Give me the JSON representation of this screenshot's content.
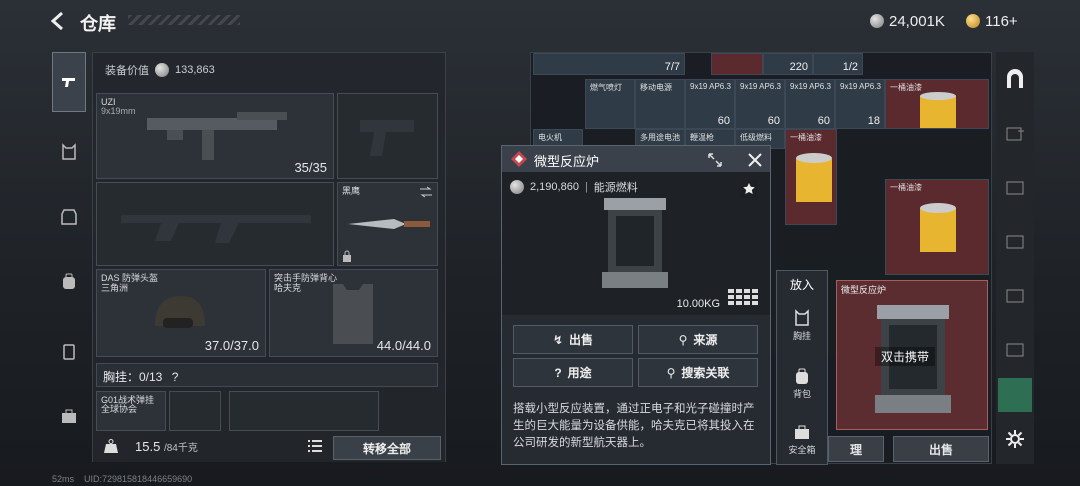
{
  "header": {
    "title": "仓库"
  },
  "currency": {
    "silver": "24,001K",
    "gold": "116+"
  },
  "equipment": {
    "value_label": "装备价值",
    "value": "133,863",
    "primary_weapon": {
      "name": "UZI",
      "sub": "9x19mm",
      "ammo": "35/35"
    },
    "melee": {
      "name": "黑鹰"
    },
    "helmet": {
      "name": "DAS 防弹头盔",
      "sub": "三角洲",
      "durability": "37.0/37.0"
    },
    "armor": {
      "name": "突击手防弹背心",
      "sub": "哈夫克",
      "durability": "44.0/44.0"
    },
    "chest_rig": {
      "label": "胸挂：0/13",
      "help": "?"
    },
    "rig_item": {
      "name": "G01战术弹挂",
      "sub": "全球协会"
    },
    "weight": "15.5",
    "weight_max": "/84千克",
    "transfer_all": "转移全部"
  },
  "storage": {
    "row1": [
      "7/7",
      "220",
      "1/2"
    ],
    "row2": [
      {
        "name": "燃气喷灯",
        "qty": ""
      },
      {
        "name": "移动电源",
        "qty": ""
      },
      {
        "name": "9x19 AP6.3",
        "qty": "60"
      },
      {
        "name": "9x19 AP6.3",
        "qty": "60"
      },
      {
        "name": "9x19 AP6.3",
        "qty": "60"
      },
      {
        "name": "9x19 AP6.3",
        "qty": "18"
      },
      {
        "name": "一桶油漆",
        "qty": ""
      }
    ],
    "row3": [
      {
        "name": "电火机"
      },
      {
        "name": "多用途电池"
      },
      {
        "name": "鞭温枪"
      },
      {
        "name": "低级燃料"
      },
      {
        "name": "一桶油漆"
      },
      {
        "name": "一桶油漆"
      }
    ],
    "selected_name": "微型反应炉",
    "double_click_hint": "双击携带",
    "sell_label": "出售",
    "organize_label": "理"
  },
  "popup": {
    "title": "微型反应炉",
    "price": "2,190,860",
    "category": "能源燃料",
    "weight": "10.00KG",
    "buttons": {
      "sell": "出售",
      "source": "来源",
      "use": "用途",
      "search": "搜索关联"
    },
    "description": "搭载小型反应装置，通过正电子和光子碰撞时产生的巨大能量为设备供能，哈夫克已将其投入在公司研发的新型航天器上。"
  },
  "context_menu": {
    "title": "放入",
    "items": [
      "胸挂",
      "背包",
      "安全箱"
    ]
  },
  "status": {
    "ping": "52ms",
    "uid": "UID:729815818446659690"
  },
  "colors": {
    "selected_bg": "#5b2c30",
    "accent_red": "#c24a4e",
    "panel_bg": "#23272d"
  }
}
